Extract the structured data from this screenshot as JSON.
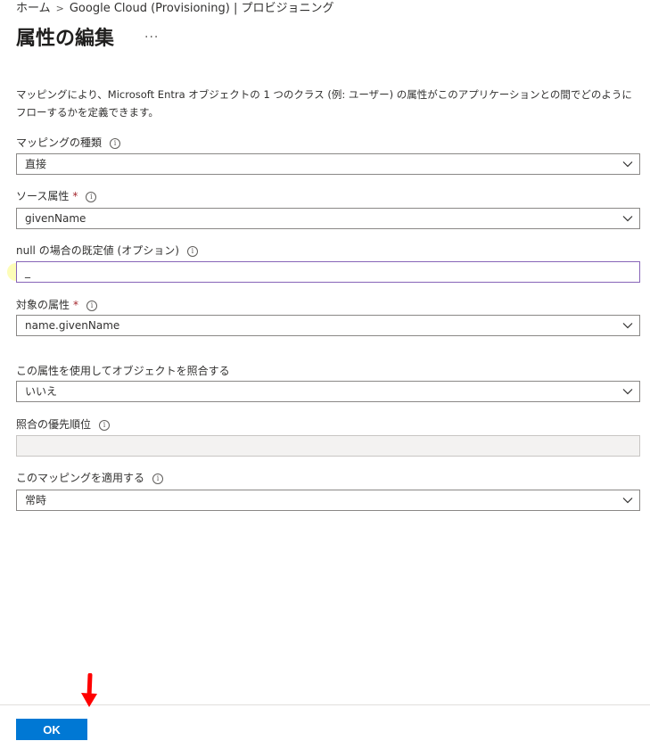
{
  "breadcrumb": {
    "home": "ホーム",
    "current": "Google Cloud (Provisioning) | プロビジョニング"
  },
  "page": {
    "title": "属性の編集",
    "more": "···"
  },
  "description": "マッピングにより、Microsoft Entra オブジェクトの 1 つのクラス (例: ユーザー) の属性がこのアプリケーションとの間でどのようにフローするかを定義できます。",
  "fields": {
    "mapping_type": {
      "label": "マッピングの種類",
      "value": "直接"
    },
    "source_attribute": {
      "label": "ソース属性",
      "required": "*",
      "value": "givenName"
    },
    "default_value": {
      "label": "null の場合の既定値 (オプション)",
      "value": "_"
    },
    "target_attribute": {
      "label": "対象の属性",
      "required": "*",
      "value": "name.givenName"
    },
    "match_objects": {
      "label": "この属性を使用してオブジェクトを照合する",
      "value": "いいえ"
    },
    "match_priority": {
      "label": "照合の優先順位",
      "value": ""
    },
    "apply_mapping": {
      "label": "このマッピングを適用する",
      "value": "常時"
    }
  },
  "icons": {
    "info": "info-icon",
    "chevron": "chevron-down-icon"
  },
  "footer": {
    "ok_label": "OK"
  },
  "colors": {
    "primary": "#0078d4",
    "required": "#a4262c",
    "focus_border": "#8764b8",
    "annotation_arrow": "#ff0000",
    "highlight": "#fdfdb0"
  }
}
